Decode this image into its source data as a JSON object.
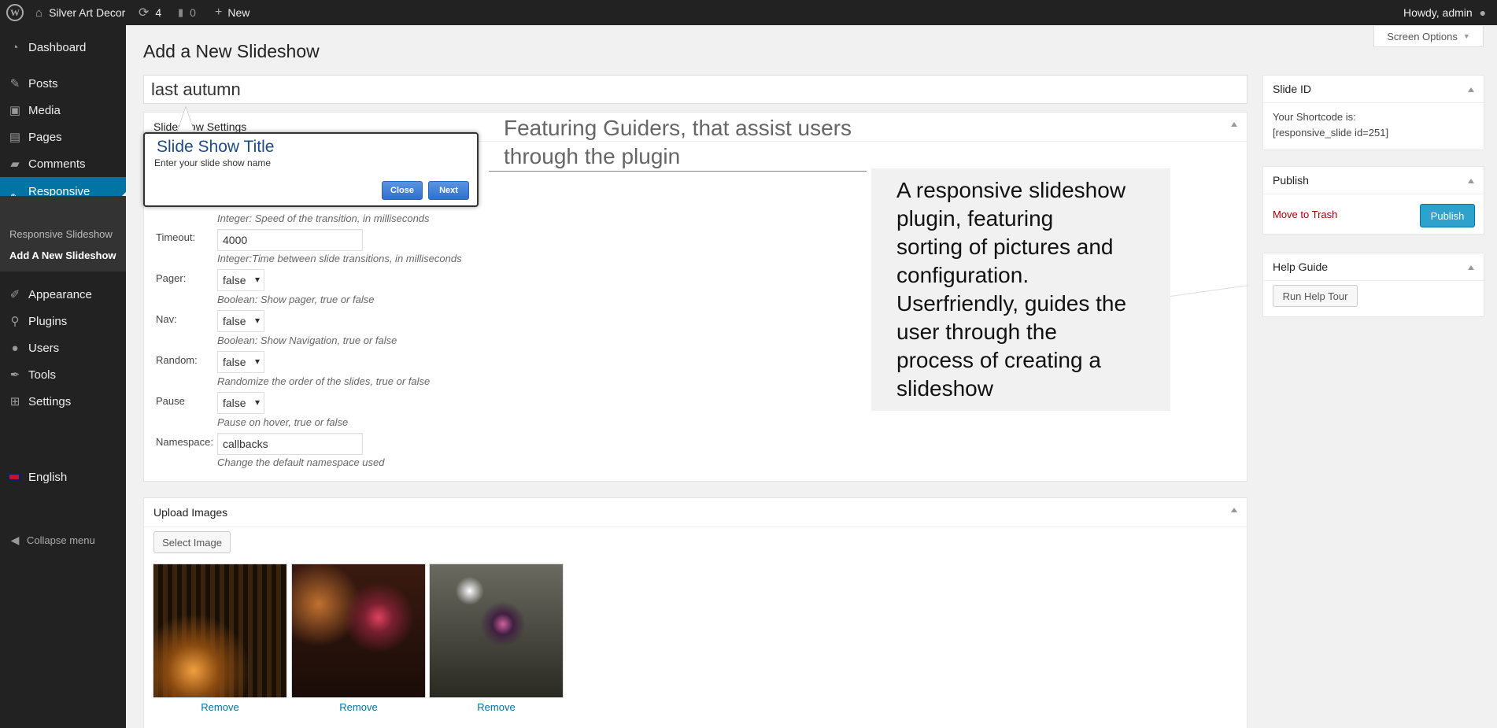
{
  "admin_bar": {
    "site_name": "Silver Art Decor",
    "updates_count": "4",
    "comments_count": "0",
    "new_label": "New",
    "greeting": "Howdy, admin"
  },
  "sidebar": {
    "items": [
      {
        "label": "Dashboard",
        "icon": "dashboard-icon"
      },
      {
        "label": "Posts",
        "icon": "pin-icon"
      },
      {
        "label": "Media",
        "icon": "media-icon"
      },
      {
        "label": "Pages",
        "icon": "pages-icon"
      },
      {
        "label": "Comments",
        "icon": "comment-icon"
      },
      {
        "label": "Responsive Slideshow",
        "icon": "pin-icon"
      },
      {
        "label": "Appearance",
        "icon": "brush-icon"
      },
      {
        "label": "Plugins",
        "icon": "plugin-icon"
      },
      {
        "label": "Users",
        "icon": "user-icon"
      },
      {
        "label": "Tools",
        "icon": "wrench-icon"
      },
      {
        "label": "Settings",
        "icon": "settings-icon"
      }
    ],
    "submenu": [
      "Responsive Slideshow",
      "Add A New Slideshow"
    ],
    "language": "English",
    "collapse_label": "Collapse menu"
  },
  "page": {
    "title": "Add a New Slideshow",
    "screen_options": "Screen Options",
    "slideshow_title_value": "last autumn"
  },
  "settings_box": {
    "title": "Slideshow Settings",
    "speed_desc": "Integer: Speed of the transition, in milliseconds",
    "timeout_label": "Timeout:",
    "timeout_value": "4000",
    "timeout_desc": "Integer:Time between slide transitions, in milliseconds",
    "pager_label": "Pager:",
    "pager_value": "false",
    "pager_desc": "Boolean: Show pager, true or false",
    "nav_label": "Nav:",
    "nav_value": "false",
    "nav_desc": "Boolean: Show Navigation, true or false",
    "random_label": "Random:",
    "random_value": "false",
    "random_desc": "Randomize the order of the slides, true or false",
    "pause_label": "Pause",
    "pause_value": "false",
    "pause_desc": "Pause on hover, true or false",
    "namespace_label": "Namespace:",
    "namespace_value": "callbacks",
    "namespace_desc": "Change the default namespace used"
  },
  "guider": {
    "title": "Slide Show Title",
    "description": "Enter your slide show name",
    "close_label": "Close",
    "next_label": "Next"
  },
  "annotations": {
    "feature_line1": "Featuring Guiders, that assist users",
    "feature_line2": "through the plugin",
    "description_lines": [
      "A responsive slideshow",
      "plugin, featuring",
      "sorting of pictures and",
      "configuration.",
      "Userfriendly, guides the",
      "user through the",
      "process of creating a",
      "slideshow"
    ]
  },
  "slide_id_box": {
    "title": "Slide ID",
    "shortcode_label": "Your Shortcode is:",
    "shortcode": "[responsive_slide id=251]"
  },
  "publish_box": {
    "title": "Publish",
    "trash_label": "Move to Trash",
    "publish_label": "Publish"
  },
  "help_box": {
    "title": "Help Guide",
    "button_label": "Run Help Tour"
  },
  "upload_box": {
    "title": "Upload Images",
    "select_label": "Select Image",
    "remove_label": "Remove"
  },
  "colors": {
    "admin_bar_bg": "#222222",
    "sidebar_bg": "#222222",
    "current_menu_bg": "#0074a2",
    "link": "#0074a2",
    "trash": "#a00000",
    "publish_bg": "#2ea2cc"
  }
}
